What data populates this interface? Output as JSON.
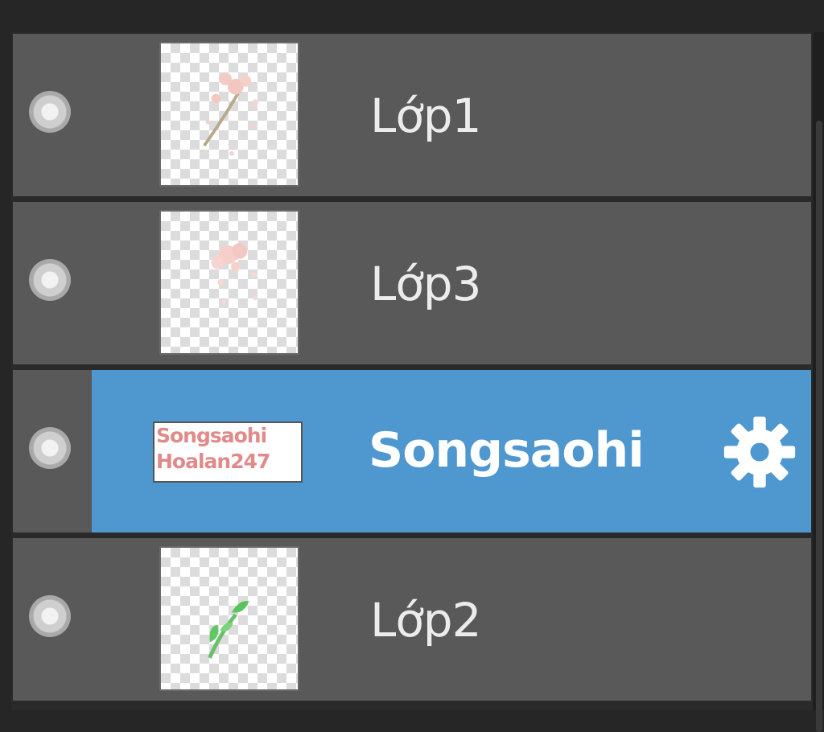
{
  "layers_panel": {
    "layers": [
      {
        "name": "Lớp1",
        "selected": false,
        "thumb_icon": "flower-branch-thumbnail"
      },
      {
        "name": "Lớp3",
        "selected": false,
        "thumb_icon": "pink-flower-thumbnail"
      },
      {
        "name": "Songsaohi",
        "selected": true,
        "thumb_text_line1": "Songsaohi",
        "thumb_text_line2": "Hoalan247",
        "settings_icon": "gear-icon"
      },
      {
        "name": "Lớp2",
        "selected": false,
        "thumb_icon": "green-leaf-thumbnail"
      }
    ]
  },
  "colors": {
    "panel_bg": "#595959",
    "selection": "#4f97cf",
    "text": "#ececec"
  }
}
